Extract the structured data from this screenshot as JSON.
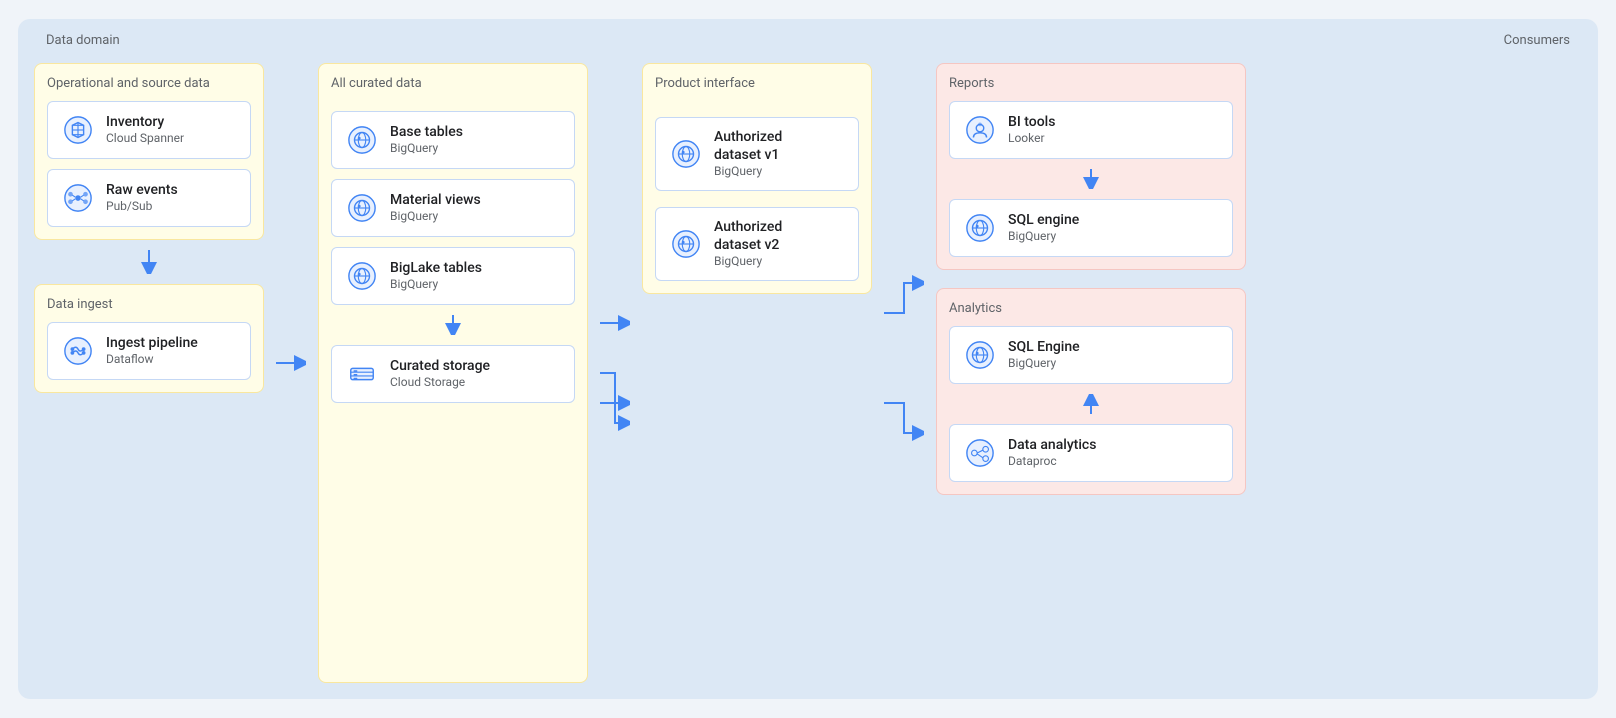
{
  "labels": {
    "data_domain": "Data domain",
    "consumers": "Consumers",
    "operational": "Operational and source data",
    "all_curated": "All curated data",
    "product_interface": "Product interface",
    "data_ingest": "Data ingest",
    "reports": "Reports",
    "analytics": "Analytics"
  },
  "services": {
    "inventory": {
      "name": "Inventory",
      "sub": "Cloud Spanner"
    },
    "raw_events": {
      "name": "Raw events",
      "sub": "Pub/Sub"
    },
    "ingest_pipeline": {
      "name": "Ingest pipeline",
      "sub": "Dataflow"
    },
    "base_tables": {
      "name": "Base tables",
      "sub": "BigQuery"
    },
    "material_views": {
      "name": "Material views",
      "sub": "BigQuery"
    },
    "biglake_tables": {
      "name": "BigLake tables",
      "sub": "BigQuery"
    },
    "curated_storage": {
      "name": "Curated storage",
      "sub": "Cloud Storage"
    },
    "auth_dataset_v1": {
      "name": "Authorized\ndataset v1",
      "sub": "BigQuery"
    },
    "auth_dataset_v2": {
      "name": "Authorized\ndataset v2",
      "sub": "BigQuery"
    },
    "bi_tools": {
      "name": "BI tools",
      "sub": "Looker"
    },
    "sql_engine_reports": {
      "name": "SQL engine",
      "sub": "BigQuery"
    },
    "sql_engine_analytics": {
      "name": "SQL Engine",
      "sub": "BigQuery"
    },
    "data_analytics": {
      "name": "Data analytics",
      "sub": "Dataproc"
    }
  },
  "colors": {
    "blue": "#4285f4",
    "icon_blue": "#4285f4",
    "bg_light_blue": "#dce8f5",
    "bg_yellow": "#fffde7",
    "bg_pink": "#fce8e6",
    "border_blue": "#c5d8f5",
    "text_dark": "#202124",
    "text_gray": "#5f6368"
  }
}
